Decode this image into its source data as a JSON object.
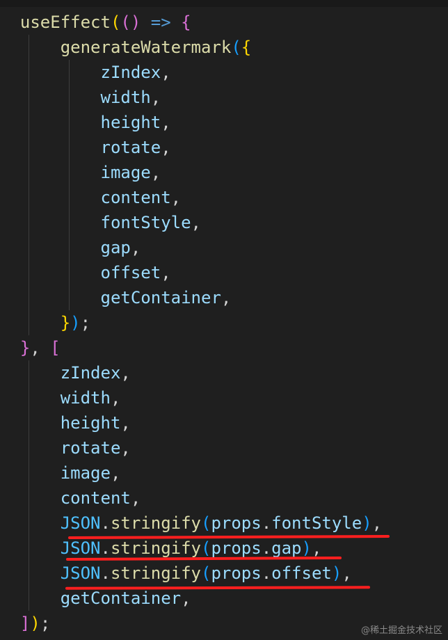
{
  "colors": {
    "background": "#1f1f1f",
    "function": "#dcdcaa",
    "variable": "#9cdcfe",
    "constant": "#4fc1ff",
    "keyword": "#569cd6",
    "bracket_level1": "#ffd700",
    "bracket_level2": "#da70d6",
    "bracket_level3": "#179fff",
    "punctuation": "#d4d4d4",
    "annotation_underline": "#ff1f1f"
  },
  "code": {
    "lines": [
      {
        "tokens": [
          {
            "t": "useEffect",
            "c": "func"
          },
          {
            "t": "(",
            "c": "p1"
          },
          {
            "t": "()",
            "c": "p2"
          },
          {
            "t": " ",
            "c": "punc"
          },
          {
            "t": "=>",
            "c": "kw"
          },
          {
            "t": " ",
            "c": "punc"
          },
          {
            "t": "{",
            "c": "p2"
          }
        ]
      },
      {
        "tokens": [
          {
            "t": "    ",
            "c": "punc"
          },
          {
            "t": "generateWatermark",
            "c": "func"
          },
          {
            "t": "(",
            "c": "p3"
          },
          {
            "t": "{",
            "c": "p1"
          }
        ]
      },
      {
        "tokens": [
          {
            "t": "        ",
            "c": "punc"
          },
          {
            "t": "zIndex",
            "c": "var"
          },
          {
            "t": ",",
            "c": "punc"
          }
        ]
      },
      {
        "tokens": [
          {
            "t": "        ",
            "c": "punc"
          },
          {
            "t": "width",
            "c": "var"
          },
          {
            "t": ",",
            "c": "punc"
          }
        ]
      },
      {
        "tokens": [
          {
            "t": "        ",
            "c": "punc"
          },
          {
            "t": "height",
            "c": "var"
          },
          {
            "t": ",",
            "c": "punc"
          }
        ]
      },
      {
        "tokens": [
          {
            "t": "        ",
            "c": "punc"
          },
          {
            "t": "rotate",
            "c": "var"
          },
          {
            "t": ",",
            "c": "punc"
          }
        ]
      },
      {
        "tokens": [
          {
            "t": "        ",
            "c": "punc"
          },
          {
            "t": "image",
            "c": "var"
          },
          {
            "t": ",",
            "c": "punc"
          }
        ]
      },
      {
        "tokens": [
          {
            "t": "        ",
            "c": "punc"
          },
          {
            "t": "content",
            "c": "var"
          },
          {
            "t": ",",
            "c": "punc"
          }
        ]
      },
      {
        "tokens": [
          {
            "t": "        ",
            "c": "punc"
          },
          {
            "t": "fontStyle",
            "c": "var"
          },
          {
            "t": ",",
            "c": "punc"
          }
        ]
      },
      {
        "tokens": [
          {
            "t": "        ",
            "c": "punc"
          },
          {
            "t": "gap",
            "c": "var"
          },
          {
            "t": ",",
            "c": "punc"
          }
        ]
      },
      {
        "tokens": [
          {
            "t": "        ",
            "c": "punc"
          },
          {
            "t": "offset",
            "c": "var"
          },
          {
            "t": ",",
            "c": "punc"
          }
        ]
      },
      {
        "tokens": [
          {
            "t": "        ",
            "c": "punc"
          },
          {
            "t": "getContainer",
            "c": "var"
          },
          {
            "t": ",",
            "c": "punc"
          }
        ]
      },
      {
        "tokens": [
          {
            "t": "    ",
            "c": "punc"
          },
          {
            "t": "}",
            "c": "p1"
          },
          {
            "t": ")",
            "c": "p3"
          },
          {
            "t": ";",
            "c": "punc"
          }
        ]
      },
      {
        "tokens": [
          {
            "t": "}",
            "c": "p2"
          },
          {
            "t": ", ",
            "c": "punc"
          },
          {
            "t": "[",
            "c": "p2"
          }
        ]
      },
      {
        "tokens": [
          {
            "t": "    ",
            "c": "punc"
          },
          {
            "t": "zIndex",
            "c": "var"
          },
          {
            "t": ",",
            "c": "punc"
          }
        ]
      },
      {
        "tokens": [
          {
            "t": "    ",
            "c": "punc"
          },
          {
            "t": "width",
            "c": "var"
          },
          {
            "t": ",",
            "c": "punc"
          }
        ]
      },
      {
        "tokens": [
          {
            "t": "    ",
            "c": "punc"
          },
          {
            "t": "height",
            "c": "var"
          },
          {
            "t": ",",
            "c": "punc"
          }
        ]
      },
      {
        "tokens": [
          {
            "t": "    ",
            "c": "punc"
          },
          {
            "t": "rotate",
            "c": "var"
          },
          {
            "t": ",",
            "c": "punc"
          }
        ]
      },
      {
        "tokens": [
          {
            "t": "    ",
            "c": "punc"
          },
          {
            "t": "image",
            "c": "var"
          },
          {
            "t": ",",
            "c": "punc"
          }
        ]
      },
      {
        "tokens": [
          {
            "t": "    ",
            "c": "punc"
          },
          {
            "t": "content",
            "c": "var"
          },
          {
            "t": ",",
            "c": "punc"
          }
        ]
      },
      {
        "tokens": [
          {
            "t": "    ",
            "c": "punc"
          },
          {
            "t": "JSON",
            "c": "const"
          },
          {
            "t": ".",
            "c": "punc"
          },
          {
            "t": "stringify",
            "c": "func"
          },
          {
            "t": "(",
            "c": "p3"
          },
          {
            "t": "props",
            "c": "var"
          },
          {
            "t": ".",
            "c": "punc"
          },
          {
            "t": "fontStyle",
            "c": "var"
          },
          {
            "t": ")",
            "c": "p3"
          },
          {
            "t": ",",
            "c": "punc"
          }
        ]
      },
      {
        "tokens": [
          {
            "t": "    ",
            "c": "punc"
          },
          {
            "t": "JSON",
            "c": "const"
          },
          {
            "t": ".",
            "c": "punc"
          },
          {
            "t": "stringify",
            "c": "func"
          },
          {
            "t": "(",
            "c": "p3"
          },
          {
            "t": "props",
            "c": "var"
          },
          {
            "t": ".",
            "c": "punc"
          },
          {
            "t": "gap",
            "c": "var"
          },
          {
            "t": ")",
            "c": "p3"
          },
          {
            "t": ",",
            "c": "punc"
          }
        ]
      },
      {
        "tokens": [
          {
            "t": "    ",
            "c": "punc"
          },
          {
            "t": "JSON",
            "c": "const"
          },
          {
            "t": ".",
            "c": "punc"
          },
          {
            "t": "stringify",
            "c": "func"
          },
          {
            "t": "(",
            "c": "p3"
          },
          {
            "t": "props",
            "c": "var"
          },
          {
            "t": ".",
            "c": "punc"
          },
          {
            "t": "offset",
            "c": "var"
          },
          {
            "t": ")",
            "c": "p3"
          },
          {
            "t": ",",
            "c": "punc"
          }
        ]
      },
      {
        "tokens": [
          {
            "t": "    ",
            "c": "punc"
          },
          {
            "t": "getContainer",
            "c": "var"
          },
          {
            "t": ",",
            "c": "punc"
          }
        ]
      },
      {
        "tokens": [
          {
            "t": "]",
            "c": "p2"
          },
          {
            "t": ")",
            "c": "p1"
          },
          {
            "t": ";",
            "c": "punc"
          }
        ]
      }
    ]
  },
  "watermark": {
    "text": "@稀土掘金技术社区"
  }
}
